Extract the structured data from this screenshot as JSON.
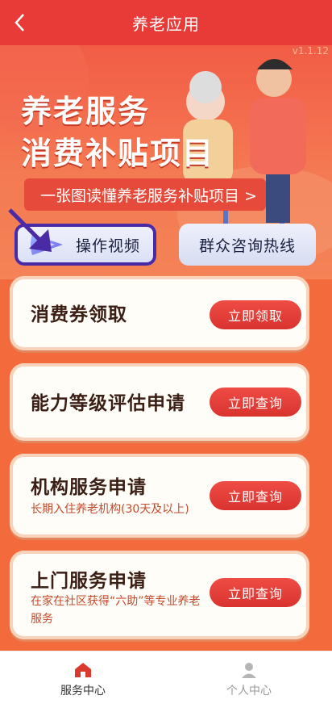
{
  "header": {
    "title": "养老应用"
  },
  "hero": {
    "version": "v1.1.12",
    "headline_line1": "养老服务",
    "headline_line2": "消费补贴项目",
    "banner_link": "一张图读懂养老服务补贴项目 >"
  },
  "quick": {
    "video_label": "操作视频",
    "hotline_label": "群众咨询热线"
  },
  "services": [
    {
      "name": "消费券领取",
      "desc": "",
      "button": "立即领取"
    },
    {
      "name": "能力等级评估申请",
      "desc": "",
      "button": "立即查询"
    },
    {
      "name": "机构服务申请",
      "desc": "长期入住养老机构(30天及以上)",
      "button": "立即查询"
    },
    {
      "name": "上门服务申请",
      "desc": "在家在社区获得“六助”等专业养老服务",
      "button": "立即查询"
    }
  ],
  "tabs": [
    {
      "label": "服务中心",
      "icon": "home-icon",
      "active": true
    },
    {
      "label": "个人中心",
      "icon": "person-icon",
      "active": false
    }
  ],
  "colors": {
    "header": "#e83a36",
    "accent": "#e8453c",
    "active_tab": "#d93a2d",
    "inactive_tab": "#999999"
  }
}
